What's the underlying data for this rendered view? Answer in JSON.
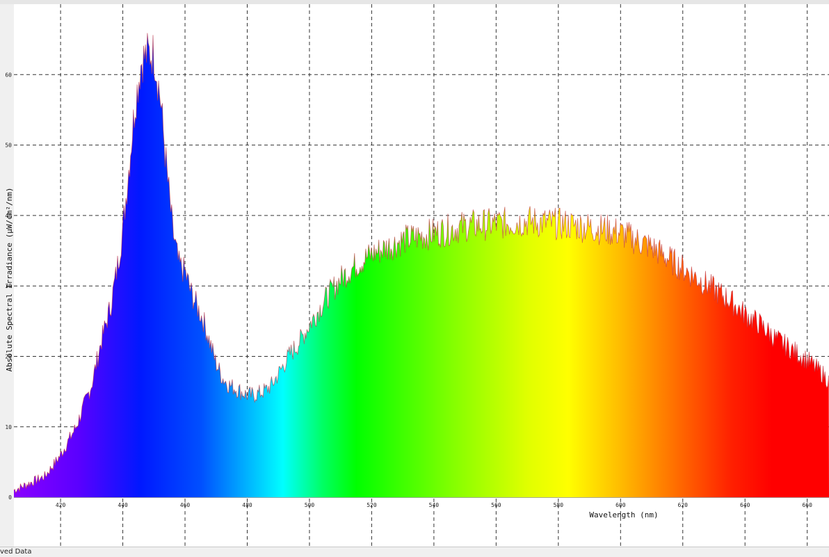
{
  "status": {
    "text": "ved Data"
  },
  "chart_data": {
    "type": "area",
    "title": "",
    "xlabel": "Wavelength (nm)",
    "ylabel": "Absolute Spectral Irradiance (µW/cm²/nm)",
    "xlim": [
      405,
      667
    ],
    "ylim": [
      -7,
      70
    ],
    "grid": true,
    "x_ticks": [
      420,
      440,
      460,
      480,
      500,
      520,
      540,
      560,
      580,
      600,
      620,
      640,
      660
    ],
    "y_ticks": [
      0,
      10,
      20,
      30,
      40,
      50,
      60
    ],
    "x": [
      405,
      410,
      415,
      420,
      425,
      430,
      433,
      436,
      438,
      440,
      442,
      444,
      446,
      448,
      450,
      452,
      454,
      456,
      458,
      460,
      462,
      464,
      466,
      468,
      470,
      472,
      474,
      476,
      478,
      480,
      482,
      484,
      486,
      488,
      490,
      492,
      494,
      496,
      498,
      500,
      505,
      510,
      515,
      520,
      525,
      530,
      535,
      540,
      545,
      550,
      555,
      560,
      565,
      570,
      575,
      580,
      585,
      590,
      595,
      600,
      605,
      610,
      615,
      620,
      625,
      630,
      635,
      640,
      645,
      650,
      655,
      660,
      665,
      667
    ],
    "values": [
      1,
      2,
      3,
      6,
      10,
      16,
      22,
      27,
      32,
      38,
      47,
      56,
      62,
      63,
      63,
      57,
      47,
      38,
      33,
      32,
      29,
      27,
      25,
      22,
      19,
      17,
      16,
      15.5,
      15,
      14.5,
      14.5,
      14.8,
      15.2,
      16,
      17.5,
      19,
      20.5,
      21.5,
      23,
      24.5,
      28,
      31,
      33,
      34.5,
      35.5,
      36.5,
      37,
      37.5,
      38,
      38.5,
      38.7,
      38.8,
      39,
      39.2,
      39,
      38.8,
      38.6,
      38.3,
      38,
      37.5,
      36.5,
      35.5,
      34,
      32.5,
      31,
      29.5,
      28,
      26,
      24.5,
      22.5,
      21,
      19.5,
      17.5,
      16.5
    ]
  }
}
